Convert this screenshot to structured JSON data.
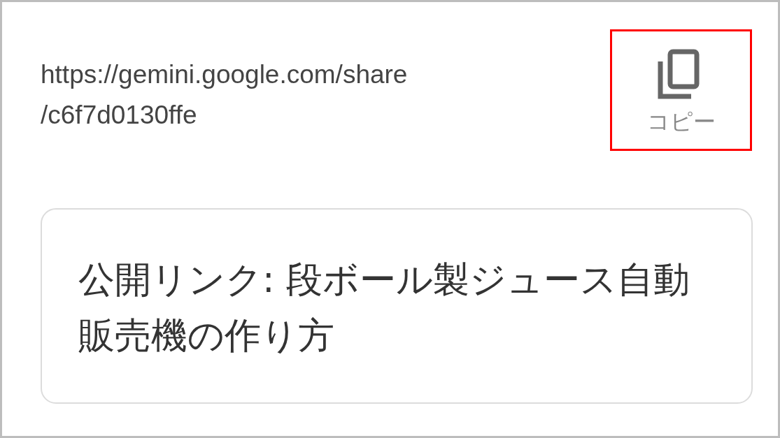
{
  "share_link": {
    "url_lines": [
      "https://gemini.google.com/share",
      "/c6f7d0130ffe"
    ]
  },
  "copy_button": {
    "label": "コピー",
    "highlighted": true
  },
  "title_card": {
    "text": "公開リンク: 段ボール製ジュース自動販売機の作り方"
  }
}
